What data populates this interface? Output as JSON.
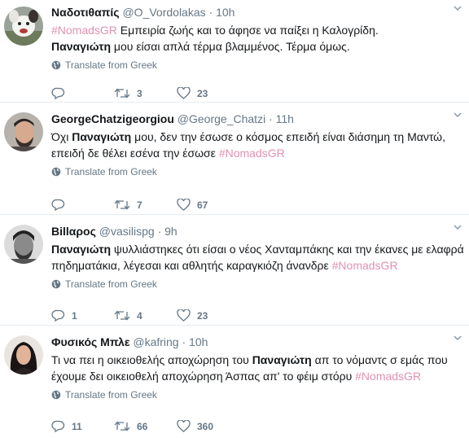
{
  "translate_label": "Translate from Greek",
  "tweets": [
    {
      "name": "Ναδοτιθαπίς",
      "handle": "@O_Vordolakas",
      "time": "10h",
      "text1": "#NomadsGR",
      "text2": " Εμπειρία ζωής και το άφησε να παίξει η Καλογρίδη.",
      "text3": "Παναγιώτη",
      "text4": " μου είσαι απλά τέρμα βλαμμένος. Τέρμα όμως.",
      "replies": "",
      "retweets": "3",
      "likes": "23"
    },
    {
      "name": "GeorgeChatzigeorgiou",
      "handle": "@George_Chatzi",
      "time": "11h",
      "text1": "Όχι ",
      "text2": "Παναγιώτη",
      "text3": " μου, δεν την έσωσε ο κόσμος επειδή είναι διάσημη τη Μαντώ, επειδή δε θέλει εσένα την έσωσε ",
      "text4": "#NomadsGR",
      "replies": "",
      "retweets": "7",
      "likes": "67"
    },
    {
      "name": "Βillαρος",
      "handle": "@vasilispg",
      "time": "9h",
      "text1": "Παναγιώτη",
      "text2": " ψυλλιάστηκες ότι είσαι ο νέος Χανταμπάκης και την έκανες με ελαφρά πηδηματάκια, λέγεσαι και αθλητής καραγκιόζη άνανδρε ",
      "text3": "#NomadsGR",
      "replies": "1",
      "retweets": "4",
      "likes": "23"
    },
    {
      "name": "Φυσικός Μπλε",
      "handle": "@kafring",
      "time": "10h",
      "text1": "Τι να πει η οικειοθελής αποχώρηση του ",
      "text2": "Παναγιώτη",
      "text3": " απ το νόμαντς σ εμάς που έχουμε δει οικειοθελή αποχώρηση Άσπας απ' το φέιμ στόρυ ",
      "text4": "#NomadsGR",
      "replies": "11",
      "retweets": "66",
      "likes": "360"
    }
  ],
  "icons": {
    "reply": "reply-icon",
    "retweet": "retweet-icon",
    "like": "heart-icon",
    "globe": "globe-icon",
    "more": "chevron-down-icon"
  },
  "colors": {
    "hashtag": "#d86b97",
    "muted": "#657786",
    "divider": "#e6ecf0"
  }
}
